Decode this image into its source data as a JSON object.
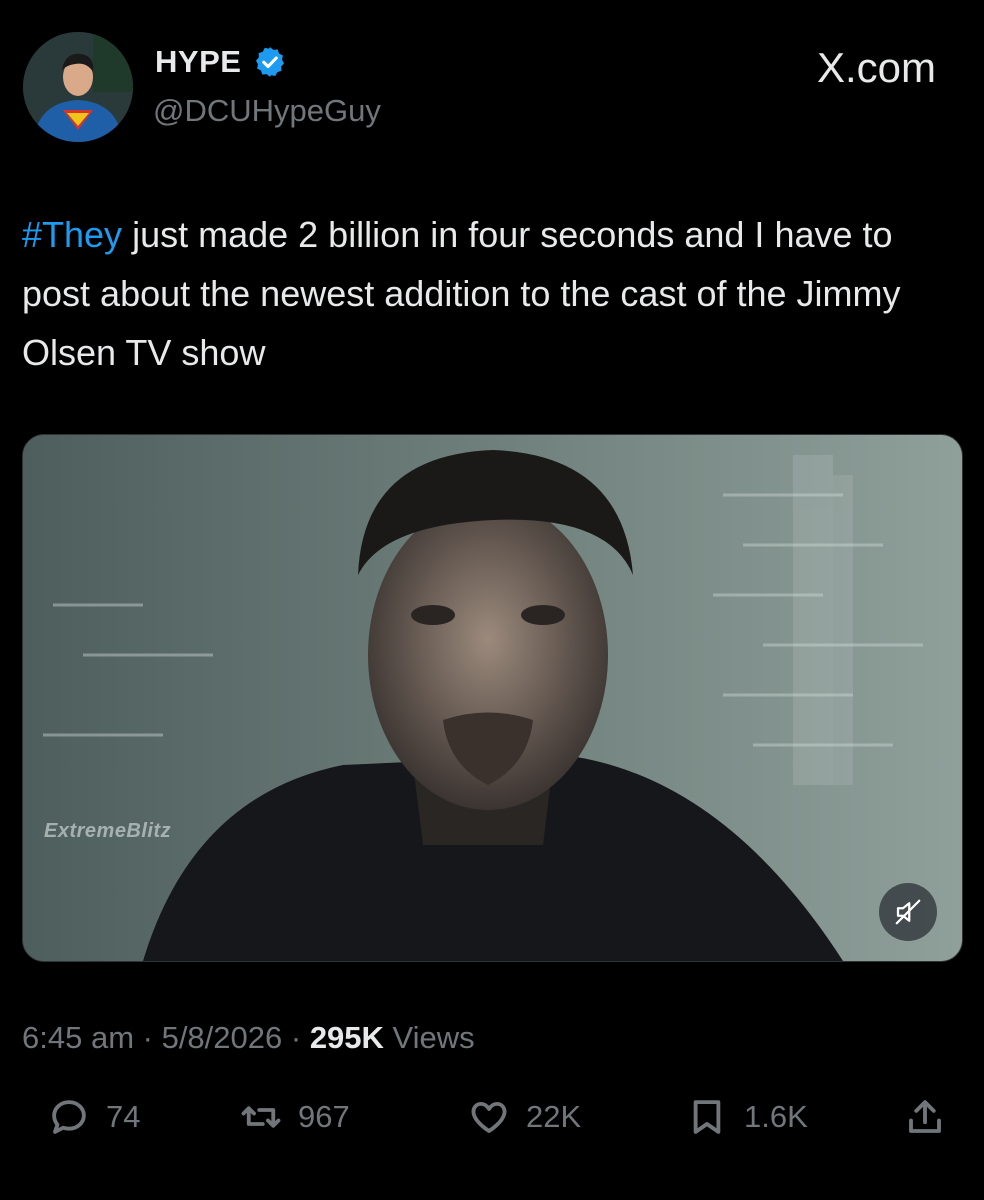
{
  "header": {
    "display_name": "HYPE",
    "handle": "@DCUHypeGuy",
    "brand": "X.com"
  },
  "tweet": {
    "hashtag": "#They",
    "text": " just made 2 billion in four seconds and I have to post about the newest addition to the cast of the Jimmy Olsen TV show"
  },
  "media": {
    "watermark": "ExtremeBlitz",
    "mute_icon": "volume-muted-icon"
  },
  "meta": {
    "time": "6:45 am",
    "sep1": " · ",
    "date": "5/8/2026",
    "sep2": " · ",
    "views_count": "295K",
    "views_label": " Views"
  },
  "actions": {
    "replies": "74",
    "reposts": "967",
    "likes": "22K",
    "bookmarks": "1.6K"
  },
  "colors": {
    "background": "#000000",
    "text": "#e7e9ea",
    "secondary": "#71767b",
    "accent": "#1d9bf0"
  },
  "icons": [
    "reply-icon",
    "repost-icon",
    "like-icon",
    "bookmark-icon",
    "share-icon",
    "verified-badge-icon",
    "volume-muted-icon"
  ]
}
